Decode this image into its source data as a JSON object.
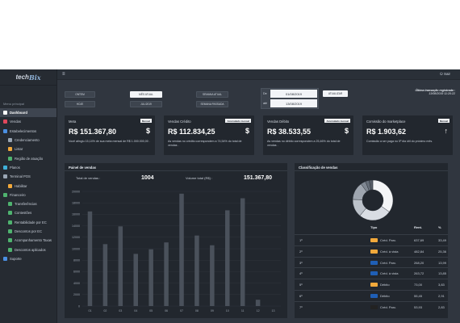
{
  "brand": {
    "name_a": "tech",
    "name_b": "Bix"
  },
  "topbar": {
    "logout_label": "Sair"
  },
  "sidebar": {
    "title": "Menu principal",
    "items": [
      {
        "label": "Dashboard",
        "color": "#ffffff",
        "sub": false,
        "active": true
      },
      {
        "label": "Vendas",
        "color": "#e0475c",
        "sub": false,
        "active": false
      },
      {
        "label": "Estabelecimentos",
        "color": "#4b8fe2",
        "sub": false,
        "active": false
      },
      {
        "label": "Credenciamento",
        "color": "#9aa6b4",
        "sub": true,
        "active": false
      },
      {
        "label": "Listar",
        "color": "#f2a93b",
        "sub": true,
        "active": false
      },
      {
        "label": "Região de atuação",
        "color": "#4fb36f",
        "sub": true,
        "active": false
      },
      {
        "label": "Planos",
        "color": "#3fb0d9",
        "sub": false,
        "active": false
      },
      {
        "label": "Terminal POS",
        "color": "#9aa6b4",
        "sub": false,
        "active": false
      },
      {
        "label": "Habilitar",
        "color": "#f2a93b",
        "sub": true,
        "active": false
      },
      {
        "label": "Financeiro",
        "color": "#4fb36f",
        "sub": false,
        "active": false
      },
      {
        "label": "Transferências",
        "color": "#4fb36f",
        "sub": true,
        "active": false
      },
      {
        "label": "Contestões",
        "color": "#4fb36f",
        "sub": true,
        "active": false
      },
      {
        "label": "Rentabilidade por EC",
        "color": "#4fb36f",
        "sub": true,
        "active": false
      },
      {
        "label": "Descontos por EC",
        "color": "#4fb36f",
        "sub": true,
        "active": false
      },
      {
        "label": "Acompanhamento Taxas",
        "color": "#4fb36f",
        "sub": true,
        "active": false
      },
      {
        "label": "Descontos aplicados",
        "color": "#4fb36f",
        "sub": true,
        "active": false
      },
      {
        "label": "Suporte",
        "color": "#4b8fe2",
        "sub": false,
        "active": false
      }
    ]
  },
  "filters": {
    "ontem": "ONTEM",
    "hoje": "HOJE",
    "mes_atual": "MÊS ATUAL",
    "jul": "JUL/2019",
    "semana_atual": "SEMANA ATUAL",
    "semana_passada": "SEMANA PASSADA",
    "de_label": "De",
    "ate_label": "até",
    "de_value": "01/08/2019",
    "ate_value": "13/08/2019",
    "atualizar": "ATUALIZAR"
  },
  "last_update": {
    "title": "Última transação registrada :",
    "value": "13/08/2019 11:20:22"
  },
  "cards": [
    {
      "title": "Meta",
      "badge": "Mensal",
      "value": "R$ 151.367,80",
      "symbol": "$",
      "desc": "Você atingiu 15,14% de sua meta mensal de R$ 1.000.000,00 ."
    },
    {
      "title": "Vendas Crédito",
      "badge": "Acumulado mensal",
      "value": "R$ 112.834,25",
      "symbol": "$",
      "desc": "As vendas no crédito correspondem a 74,54% do total de vendas ."
    },
    {
      "title": "Vendas Débito",
      "badge": "Acumulado mensal",
      "value": "R$ 38.533,55",
      "symbol": "$",
      "desc": "As vendas no débito correspondem a 25,46% do total de vendas ."
    },
    {
      "title": "Comissão do marketplace",
      "badge": "Mensal",
      "value": "R$ 1.903,62",
      "symbol": "↑",
      "desc": "Comissão a ser paga no 5º dia útil do próximo mês."
    }
  ],
  "painel": {
    "title": "Painel de vendas",
    "total_vendas_label": "Total de vendas :",
    "total_vendas_value": "1004",
    "volume_label": "Volume total (R$) :",
    "volume_value": "151.367,80"
  },
  "chart_data": {
    "type": "bar",
    "categories": [
      "01",
      "02",
      "03",
      "04",
      "05",
      "06",
      "07",
      "08",
      "09",
      "10",
      "11",
      "12",
      "13"
    ],
    "values": [
      16500,
      10800,
      13900,
      9100,
      9900,
      11100,
      19600,
      12300,
      10600,
      16700,
      18800,
      1100,
      0
    ],
    "ylim": [
      0,
      20000
    ],
    "yticks": [
      "0",
      "2000",
      "4000",
      "6000",
      "8000",
      "10000",
      "12000",
      "14000",
      "16000",
      "18000",
      "20000"
    ],
    "bar_color": "#4a515b"
  },
  "classificacao": {
    "title": "Classificação de vendas",
    "headers": {
      "tipo": "Tipo",
      "rent": "Rent.",
      "pct": "%"
    },
    "rows": [
      {
        "rank": "1º",
        "tipo": "Créd. Parc.",
        "rent": "637,69",
        "pct": "33,49",
        "flag": "#f2a93b"
      },
      {
        "rank": "2º",
        "tipo": "Créd. à vista",
        "rent": "482,84",
        "pct": "25,36",
        "flag": "#f2a93b"
      },
      {
        "rank": "3º",
        "tipo": "Créd. Parc.",
        "rent": "268,20",
        "pct": "13,99",
        "flag": "#1f5fb6"
      },
      {
        "rank": "4º",
        "tipo": "Créd. à vista",
        "rent": "263,72",
        "pct": "13,85",
        "flag": "#1f5fb6"
      },
      {
        "rank": "5º",
        "tipo": "Débito",
        "rent": "73,00",
        "pct": "3,83",
        "flag": "#f2a93b"
      },
      {
        "rank": "6º",
        "tipo": "Débito",
        "rent": "55,45",
        "pct": "2,91",
        "flag": "#1f5fb6"
      },
      {
        "rank": "7º",
        "tipo": "Créd. Parc.",
        "rent": "53,93",
        "pct": "2,83",
        "flag": "#222222"
      }
    ],
    "donut": [
      33.49,
      25.36,
      13.99,
      13.85,
      3.83,
      2.91,
      2.83
    ],
    "donut_colors": [
      "#f4f5f7",
      "#d9dde3",
      "#bcc2ca",
      "#9ea5af",
      "#7f8792",
      "#666e79",
      "#555c66"
    ]
  }
}
